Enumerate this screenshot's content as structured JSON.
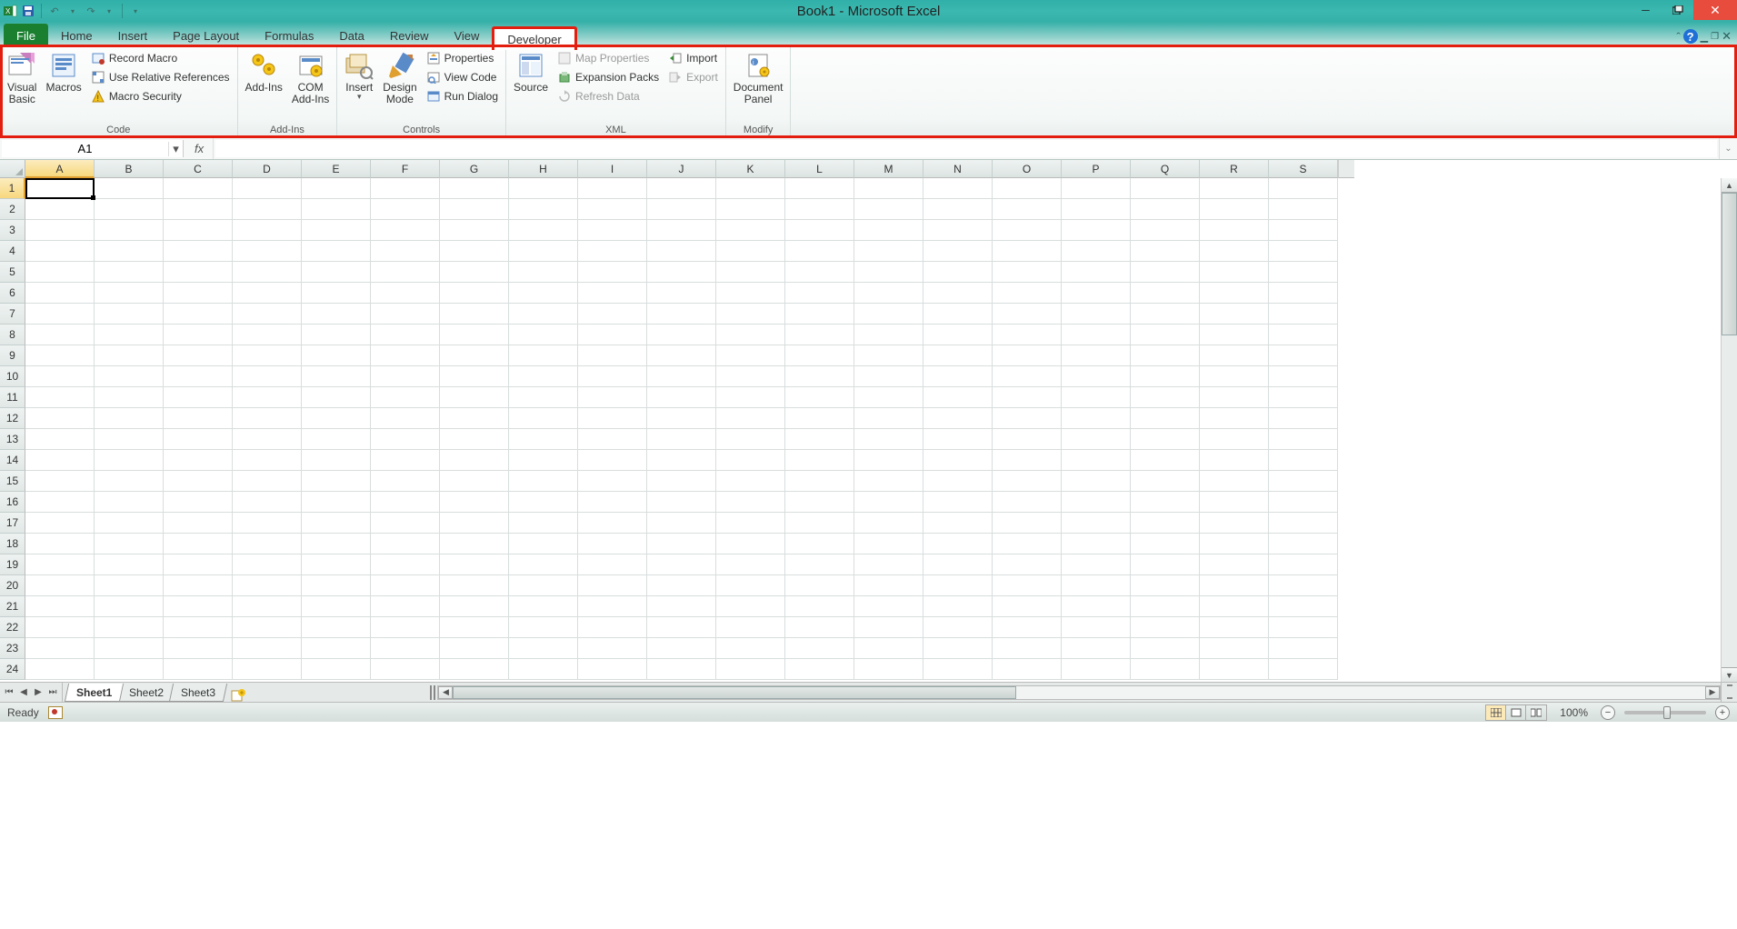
{
  "titlebar": {
    "title": "Book1 - Microsoft Excel"
  },
  "tabs": {
    "file": "File",
    "items": [
      "Home",
      "Insert",
      "Page Layout",
      "Formulas",
      "Data",
      "Review",
      "View",
      "Developer"
    ],
    "active": "Developer"
  },
  "ribbon": {
    "code": {
      "label": "Code",
      "visual_basic": "Visual\nBasic",
      "macros": "Macros",
      "record": "Record Macro",
      "relative": "Use Relative References",
      "security": "Macro Security"
    },
    "addins": {
      "label": "Add-Ins",
      "addins": "Add-Ins",
      "com": "COM\nAdd-Ins"
    },
    "controls": {
      "label": "Controls",
      "insert": "Insert",
      "design": "Design\nMode",
      "properties": "Properties",
      "view_code": "View Code",
      "run_dialog": "Run Dialog"
    },
    "xml": {
      "label": "XML",
      "source": "Source",
      "map": "Map Properties",
      "expansion": "Expansion Packs",
      "refresh": "Refresh Data",
      "import": "Import",
      "export": "Export"
    },
    "modify": {
      "label": "Modify",
      "docpanel": "Document\nPanel"
    }
  },
  "formulabar": {
    "namebox": "A1",
    "fx": "fx",
    "formula": ""
  },
  "grid": {
    "columns": [
      "A",
      "B",
      "C",
      "D",
      "E",
      "F",
      "G",
      "H",
      "I",
      "J",
      "K",
      "L",
      "M",
      "N",
      "O",
      "P",
      "Q",
      "R",
      "S"
    ],
    "rows": [
      "1",
      "2",
      "3",
      "4",
      "5",
      "6",
      "7",
      "8",
      "9",
      "10",
      "11",
      "12",
      "13",
      "14",
      "15",
      "16",
      "17",
      "18",
      "19",
      "20",
      "21",
      "22",
      "23",
      "24"
    ],
    "active_cell": "A1"
  },
  "sheets": {
    "tabs": [
      "Sheet1",
      "Sheet2",
      "Sheet3"
    ],
    "active": "Sheet1"
  },
  "statusbar": {
    "state": "Ready",
    "zoom": "100%"
  }
}
